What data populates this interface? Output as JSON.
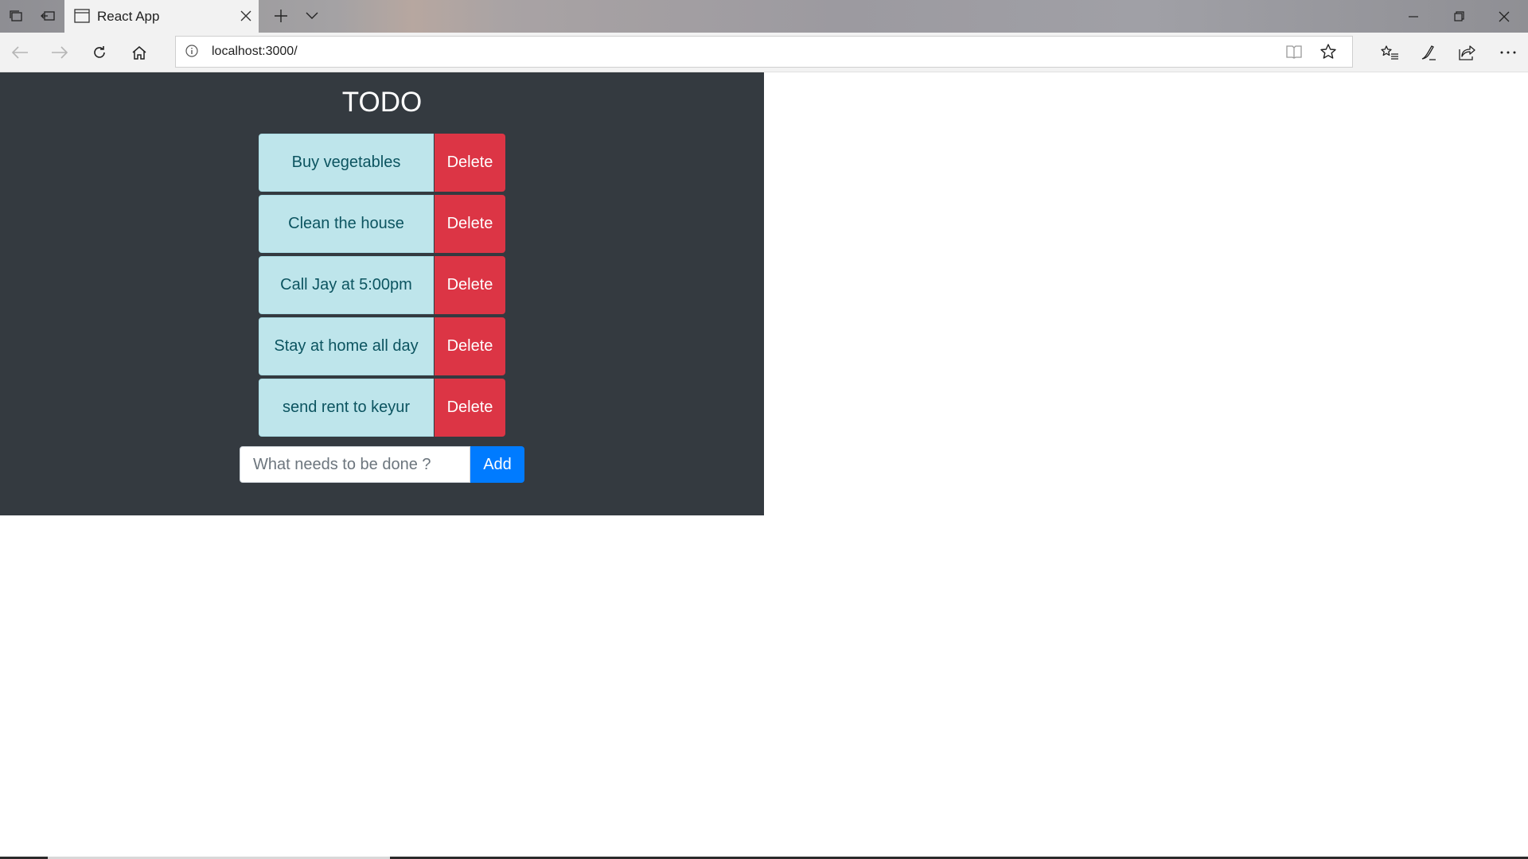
{
  "browser": {
    "tab_title": "React App",
    "url": "localhost:3000/"
  },
  "icons": {
    "set_aside": "tabs-aside-icon",
    "show_aside": "restore-tabs-icon",
    "page": "page-icon",
    "close_tab": "close-icon",
    "new_tab": "plus-icon",
    "tab_preview": "chevron-down-icon",
    "minimize": "minimize-icon",
    "restore": "restore-icon",
    "close_window": "close-icon",
    "back": "back-arrow-icon",
    "forward": "forward-arrow-icon",
    "refresh": "refresh-icon",
    "home": "home-icon",
    "info": "info-icon",
    "reading_view": "reading-view-icon",
    "favorite": "star-icon",
    "favorites_hub": "favorites-list-icon",
    "notes": "pen-icon",
    "share": "share-icon",
    "more": "more-icon"
  },
  "colors": {
    "app_background": "#343a40",
    "item_background": "#bee5eb",
    "item_text": "#0c5460",
    "delete": "#dc3545",
    "add": "#007bff"
  },
  "app": {
    "title": "TODO",
    "todos": [
      {
        "text": "Buy vegetables",
        "delete_label": "Delete"
      },
      {
        "text": "Clean the house",
        "delete_label": "Delete"
      },
      {
        "text": "Call Jay at 5:00pm",
        "delete_label": "Delete"
      },
      {
        "text": "Stay at home all day",
        "delete_label": "Delete"
      },
      {
        "text": "send rent to keyur",
        "delete_label": "Delete"
      }
    ],
    "input_placeholder": "What needs to be done ?",
    "input_value": "",
    "add_label": "Add"
  }
}
